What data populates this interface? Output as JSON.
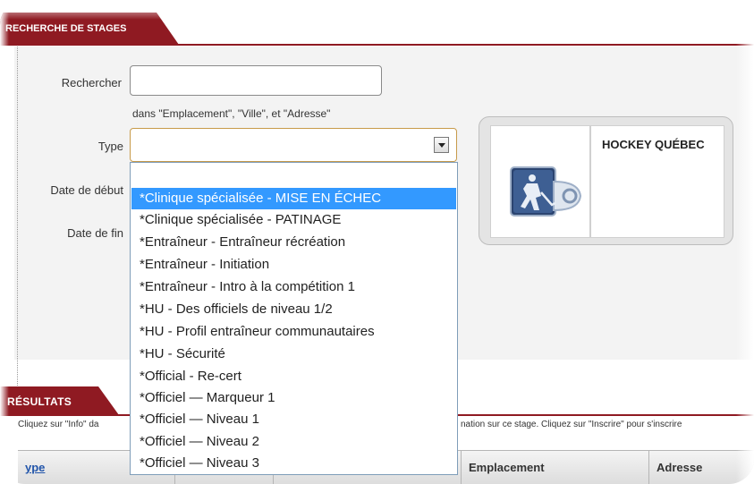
{
  "header": {
    "tab_label": "RECHERCHE DE STAGES"
  },
  "form": {
    "search_label": "Rechercher",
    "search_value": "",
    "search_hint": "dans \"Emplacement\", \"Ville\", et \"Adresse\"",
    "type_label": "Type",
    "type_value": "",
    "start_date_label": "Date de début",
    "end_date_label": "Date de fin"
  },
  "organization": {
    "name": "HOCKEY QUÉBEC"
  },
  "type_dropdown": {
    "options": [
      "",
      "*Clinique spécialisée - MISE EN ÉCHEC",
      "*Clinique spécialisée - PATINAGE",
      "*Entraîneur - Entraîneur récréation",
      "*Entraîneur - Initiation",
      "*Entraîneur - Intro à la compétition 1",
      "*HU - Des officiels de niveau 1/2",
      "*HU - Profil entraîneur communautaires",
      "*HU - Sécurité",
      "*Official - Re-cert",
      "*Officiel — Marqueur 1",
      "*Officiel — Niveau 1",
      "*Officiel — Niveau 2",
      "*Officiel — Niveau 3"
    ],
    "selected_index": 1
  },
  "results": {
    "tab_label": "RÉSULTATS",
    "instructions_left": "Cliquez sur \"Info\" da",
    "instructions_right": "nation sur ce stage. Cliquez sur \"Inscrire\" pour s'inscrire",
    "columns": [
      "ype",
      "",
      "",
      "Emplacement",
      "Adresse"
    ]
  },
  "colors": {
    "accent": "#8f1a22",
    "selection": "#3399ff",
    "panel": "#f3f3f3"
  }
}
